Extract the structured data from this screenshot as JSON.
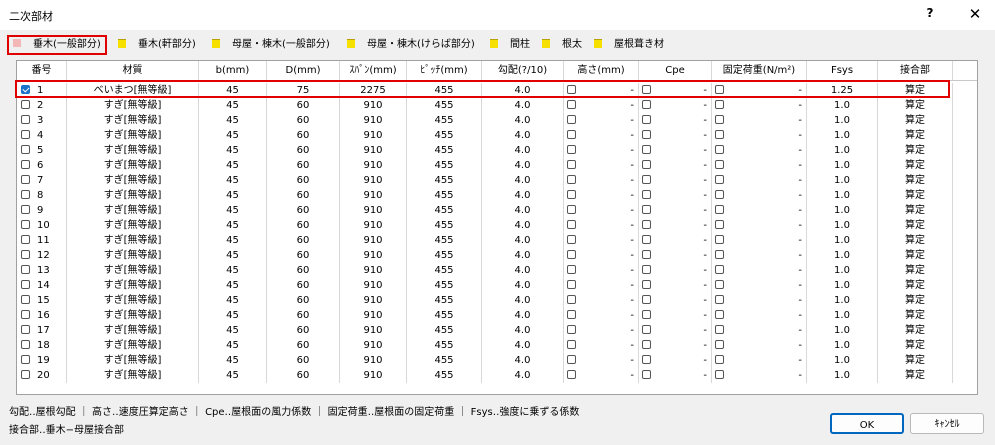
{
  "window": {
    "title": "二次部材",
    "help_label": "?",
    "close_label": "✕"
  },
  "tabs": [
    {
      "label": "垂木(一般部分)",
      "color": "#f4b7b7",
      "active": true
    },
    {
      "label": "垂木(軒部分)",
      "color": "#f6e000",
      "active": false
    },
    {
      "label": "母屋・棟木(一般部分)",
      "color": "#f6e000",
      "active": false
    },
    {
      "label": "母屋・棟木(けらば部分)",
      "color": "#f6e000",
      "active": false
    },
    {
      "label": "間柱",
      "color": "#f6e000",
      "active": false
    },
    {
      "label": "根太",
      "color": "#f6e000",
      "active": false
    },
    {
      "label": "屋根葺き材",
      "color": "#f6e000",
      "active": false
    }
  ],
  "table": {
    "headers": [
      "番号",
      "材質",
      "b(mm)",
      "D(mm)",
      "ｽﾊﾟﾝ(mm)",
      "ﾋﾟｯﾁ(mm)",
      "勾配(?/10)",
      "高さ(mm)",
      "Cpe",
      "固定荷重(N/m²)",
      "Fsys",
      "接合部"
    ],
    "rows": [
      {
        "no": "1",
        "checked": true,
        "material": "べいまつ[無等級]",
        "b": "45",
        "d": "75",
        "span": "2275",
        "pitch": "455",
        "slope": "4.0",
        "height": "-",
        "cpe": "-",
        "load": "-",
        "fsys": "1.25",
        "joint": "算定"
      },
      {
        "no": "2",
        "checked": false,
        "material": "すぎ[無等級]",
        "b": "45",
        "d": "60",
        "span": "910",
        "pitch": "455",
        "slope": "4.0",
        "height": "-",
        "cpe": "-",
        "load": "-",
        "fsys": "1.0",
        "joint": "算定"
      },
      {
        "no": "3",
        "checked": false,
        "material": "すぎ[無等級]",
        "b": "45",
        "d": "60",
        "span": "910",
        "pitch": "455",
        "slope": "4.0",
        "height": "-",
        "cpe": "-",
        "load": "-",
        "fsys": "1.0",
        "joint": "算定"
      },
      {
        "no": "4",
        "checked": false,
        "material": "すぎ[無等級]",
        "b": "45",
        "d": "60",
        "span": "910",
        "pitch": "455",
        "slope": "4.0",
        "height": "-",
        "cpe": "-",
        "load": "-",
        "fsys": "1.0",
        "joint": "算定"
      },
      {
        "no": "5",
        "checked": false,
        "material": "すぎ[無等級]",
        "b": "45",
        "d": "60",
        "span": "910",
        "pitch": "455",
        "slope": "4.0",
        "height": "-",
        "cpe": "-",
        "load": "-",
        "fsys": "1.0",
        "joint": "算定"
      },
      {
        "no": "6",
        "checked": false,
        "material": "すぎ[無等級]",
        "b": "45",
        "d": "60",
        "span": "910",
        "pitch": "455",
        "slope": "4.0",
        "height": "-",
        "cpe": "-",
        "load": "-",
        "fsys": "1.0",
        "joint": "算定"
      },
      {
        "no": "7",
        "checked": false,
        "material": "すぎ[無等級]",
        "b": "45",
        "d": "60",
        "span": "910",
        "pitch": "455",
        "slope": "4.0",
        "height": "-",
        "cpe": "-",
        "load": "-",
        "fsys": "1.0",
        "joint": "算定"
      },
      {
        "no": "8",
        "checked": false,
        "material": "すぎ[無等級]",
        "b": "45",
        "d": "60",
        "span": "910",
        "pitch": "455",
        "slope": "4.0",
        "height": "-",
        "cpe": "-",
        "load": "-",
        "fsys": "1.0",
        "joint": "算定"
      },
      {
        "no": "9",
        "checked": false,
        "material": "すぎ[無等級]",
        "b": "45",
        "d": "60",
        "span": "910",
        "pitch": "455",
        "slope": "4.0",
        "height": "-",
        "cpe": "-",
        "load": "-",
        "fsys": "1.0",
        "joint": "算定"
      },
      {
        "no": "10",
        "checked": false,
        "material": "すぎ[無等級]",
        "b": "45",
        "d": "60",
        "span": "910",
        "pitch": "455",
        "slope": "4.0",
        "height": "-",
        "cpe": "-",
        "load": "-",
        "fsys": "1.0",
        "joint": "算定"
      },
      {
        "no": "11",
        "checked": false,
        "material": "すぎ[無等級]",
        "b": "45",
        "d": "60",
        "span": "910",
        "pitch": "455",
        "slope": "4.0",
        "height": "-",
        "cpe": "-",
        "load": "-",
        "fsys": "1.0",
        "joint": "算定"
      },
      {
        "no": "12",
        "checked": false,
        "material": "すぎ[無等級]",
        "b": "45",
        "d": "60",
        "span": "910",
        "pitch": "455",
        "slope": "4.0",
        "height": "-",
        "cpe": "-",
        "load": "-",
        "fsys": "1.0",
        "joint": "算定"
      },
      {
        "no": "13",
        "checked": false,
        "material": "すぎ[無等級]",
        "b": "45",
        "d": "60",
        "span": "910",
        "pitch": "455",
        "slope": "4.0",
        "height": "-",
        "cpe": "-",
        "load": "-",
        "fsys": "1.0",
        "joint": "算定"
      },
      {
        "no": "14",
        "checked": false,
        "material": "すぎ[無等級]",
        "b": "45",
        "d": "60",
        "span": "910",
        "pitch": "455",
        "slope": "4.0",
        "height": "-",
        "cpe": "-",
        "load": "-",
        "fsys": "1.0",
        "joint": "算定"
      },
      {
        "no": "15",
        "checked": false,
        "material": "すぎ[無等級]",
        "b": "45",
        "d": "60",
        "span": "910",
        "pitch": "455",
        "slope": "4.0",
        "height": "-",
        "cpe": "-",
        "load": "-",
        "fsys": "1.0",
        "joint": "算定"
      },
      {
        "no": "16",
        "checked": false,
        "material": "すぎ[無等級]",
        "b": "45",
        "d": "60",
        "span": "910",
        "pitch": "455",
        "slope": "4.0",
        "height": "-",
        "cpe": "-",
        "load": "-",
        "fsys": "1.0",
        "joint": "算定"
      },
      {
        "no": "17",
        "checked": false,
        "material": "すぎ[無等級]",
        "b": "45",
        "d": "60",
        "span": "910",
        "pitch": "455",
        "slope": "4.0",
        "height": "-",
        "cpe": "-",
        "load": "-",
        "fsys": "1.0",
        "joint": "算定"
      },
      {
        "no": "18",
        "checked": false,
        "material": "すぎ[無等級]",
        "b": "45",
        "d": "60",
        "span": "910",
        "pitch": "455",
        "slope": "4.0",
        "height": "-",
        "cpe": "-",
        "load": "-",
        "fsys": "1.0",
        "joint": "算定"
      },
      {
        "no": "19",
        "checked": false,
        "material": "すぎ[無等級]",
        "b": "45",
        "d": "60",
        "span": "910",
        "pitch": "455",
        "slope": "4.0",
        "height": "-",
        "cpe": "-",
        "load": "-",
        "fsys": "1.0",
        "joint": "算定"
      },
      {
        "no": "20",
        "checked": false,
        "material": "すぎ[無等級]",
        "b": "45",
        "d": "60",
        "span": "910",
        "pitch": "455",
        "slope": "4.0",
        "height": "-",
        "cpe": "-",
        "load": "-",
        "fsys": "1.0",
        "joint": "算定"
      }
    ]
  },
  "notes": {
    "line1": "勾配‥屋根勾配 ｜ 高さ‥速度圧算定高さ ｜ Cpe‥屋根面の風力係数 ｜ 固定荷重‥屋根面の固定荷重 ｜ Fsys‥強度に乗ずる係数",
    "line2": "接合部‥垂木−母屋接合部"
  },
  "buttons": {
    "ok_label": "OK",
    "cancel_label": "ｷｬﾝｾﾙ"
  },
  "colors": {
    "highlight": "#e00000",
    "check_accent": "#1a73c8",
    "ok_border": "#0067c0"
  }
}
